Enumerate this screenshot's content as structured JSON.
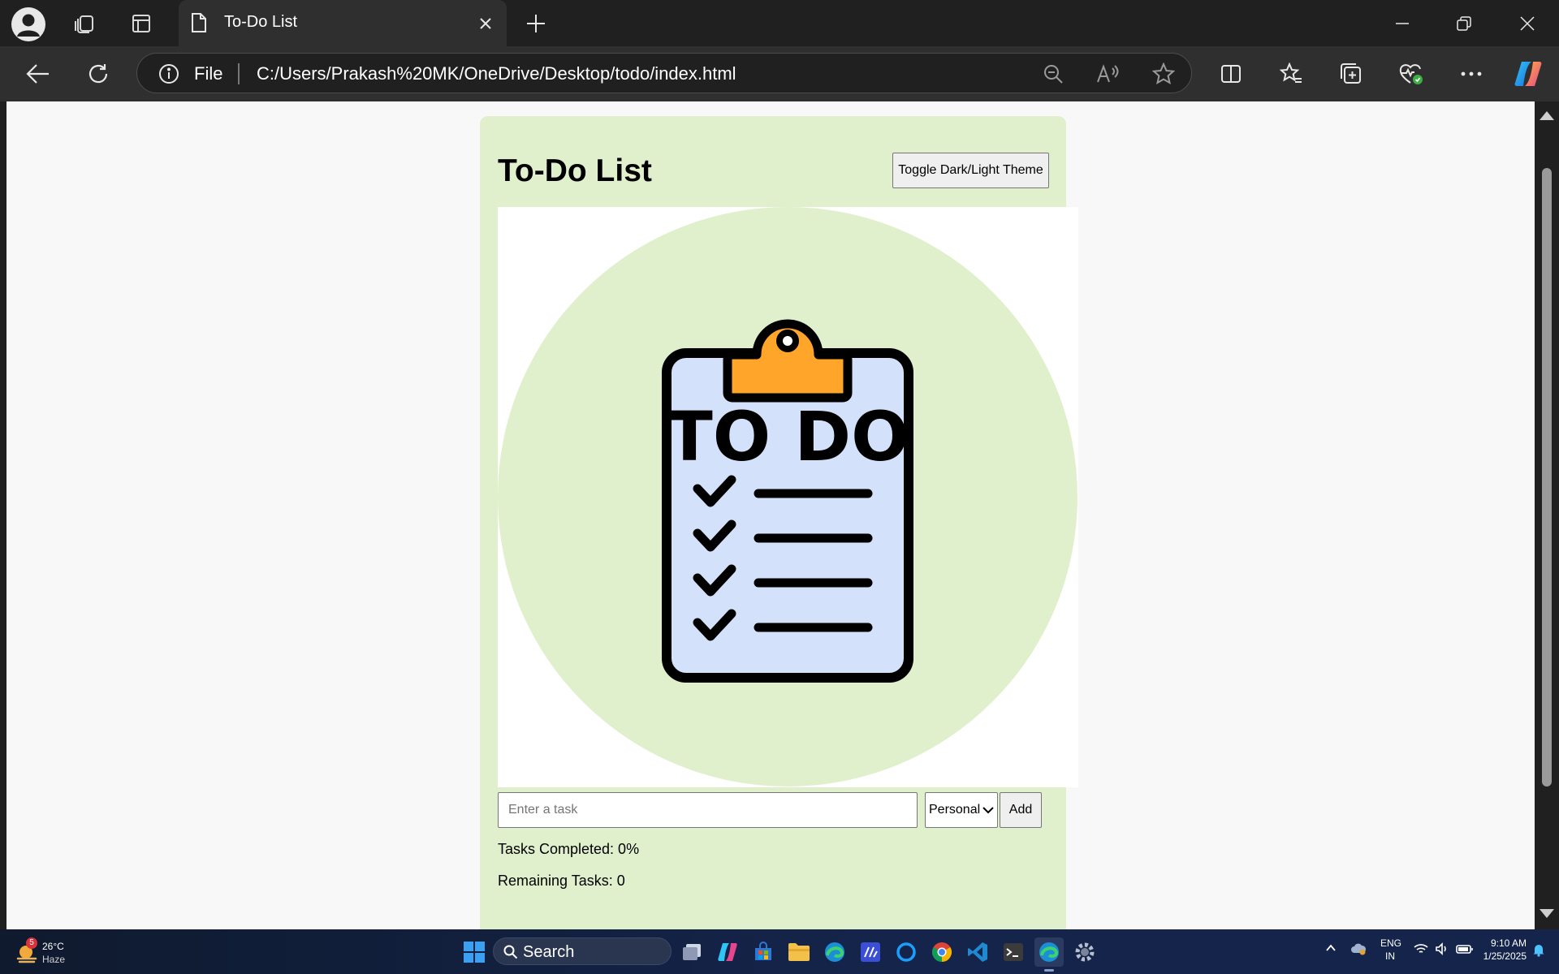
{
  "browser": {
    "tab_title": "To-Do List",
    "address": {
      "scheme_label": "File",
      "url": "C:/Users/Prakash%20MK/OneDrive/Desktop/todo/index.html"
    },
    "accent_color": "#0078d4"
  },
  "page": {
    "title": "To-Do List",
    "theme_toggle_label": "Toggle Dark/Light Theme",
    "hero_image": {
      "lettering": "TO DO",
      "circle_color": "#e1f0cc",
      "board_color": "#d3e1fb",
      "clip_color": "#ffa52a"
    },
    "task_input_placeholder": "Enter a task",
    "task_input_value": "",
    "category_selected": "Personal",
    "add_label": "Add",
    "tasks_completed": "Tasks Completed: 0%",
    "remaining_tasks": "Remaining Tasks: 0",
    "card_color": "#e1f0cc"
  },
  "taskbar": {
    "weather": {
      "temp": "26°C",
      "condition": "Haze",
      "badge": "5"
    },
    "search_label": "Search",
    "language": {
      "line1": "ENG",
      "line2": "IN"
    },
    "clock": {
      "time": "9:10 AM",
      "date": "1/25/2025"
    }
  }
}
